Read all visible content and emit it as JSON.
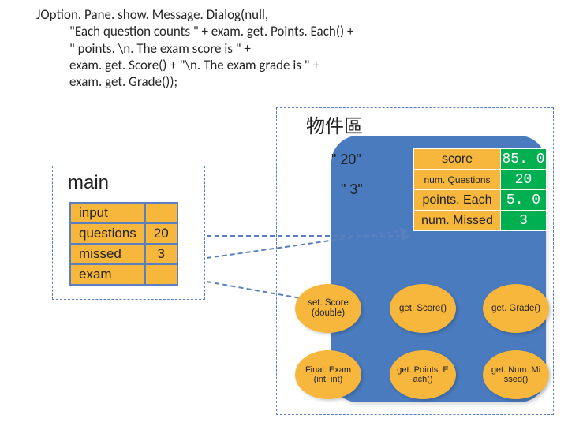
{
  "code": {
    "l1": "JOption. Pane. show. Message. Dialog(null,",
    "l2": "\"Each question counts \" + exam. get. Points. Each() +",
    "l3": "\" points. \\n. The exam score is \" +",
    "l4": "exam. get. Score() + \"\\n. The exam grade is \" +",
    "l5": "exam. get. Grade());"
  },
  "labels": {
    "object_area": "物件區",
    "main": "main"
  },
  "main_vars": {
    "rows": [
      {
        "name": "input",
        "val": ""
      },
      {
        "name": "questions",
        "val": "20"
      },
      {
        "name": "missed",
        "val": "3"
      },
      {
        "name": "exam",
        "val": ""
      }
    ]
  },
  "floating": {
    "q20": "\" 20\"",
    "q3": "\" 3\""
  },
  "fields": [
    {
      "name": "score",
      "val": "85. 0"
    },
    {
      "name": "num. Questions",
      "val": "20",
      "sub": true
    },
    {
      "name": "points. Each",
      "val": "5. 0"
    },
    {
      "name": "num. Missed",
      "val": "3"
    }
  ],
  "methods": {
    "setScore": "set. Score (double)",
    "getScore": "get. Score()",
    "getGrade": "get. Grade()",
    "finalExam": "Final. Exam (int, int)",
    "getPointsEach": "get. Points. E ach()",
    "getNumMissed": "get. Num. Mi ssed()"
  }
}
